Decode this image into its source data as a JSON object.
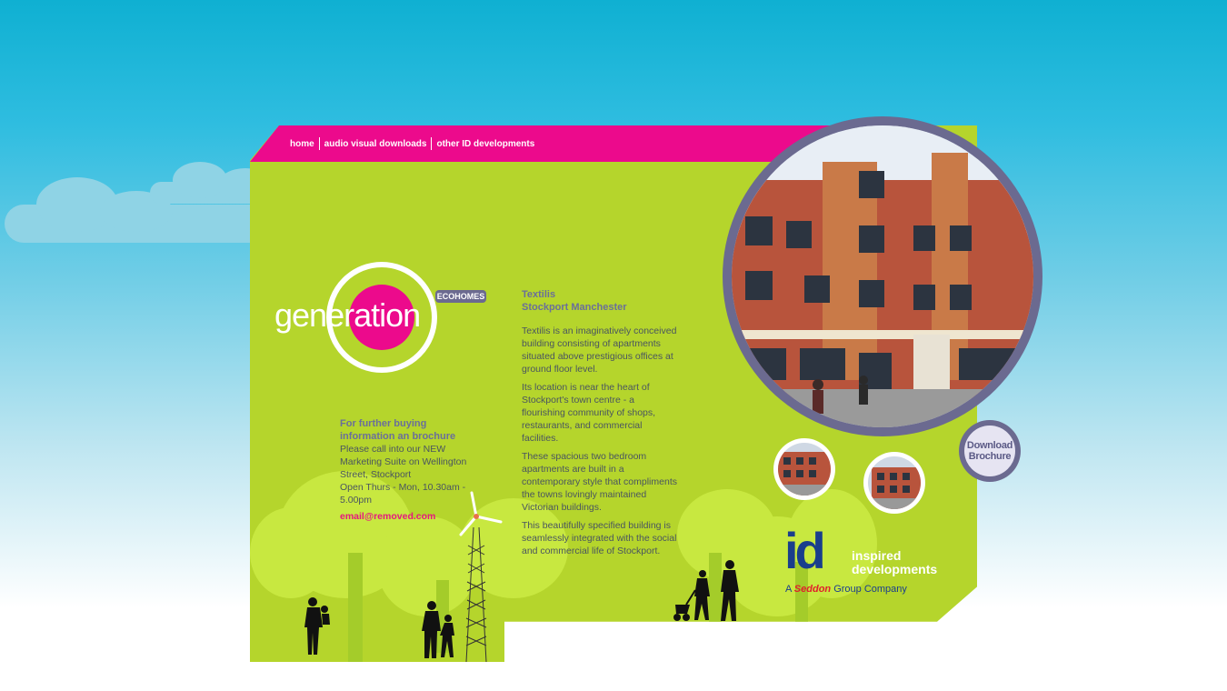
{
  "nav": {
    "items": [
      "home",
      "audio visual downloads",
      "other ID developments"
    ]
  },
  "logo": {
    "badge": "ECOHOMES",
    "word_part1": "gen",
    "word_part2": "era",
    "word_part3": "tion"
  },
  "contact": {
    "heading": "For further buying information an brochure",
    "body": "Please call into our NEW Marketing Suite on Wellington Street, Stockport",
    "hours": "Open Thurs - Mon, 10.30am - 5.00pm",
    "email": "email@removed.com"
  },
  "development": {
    "title": "Textilis",
    "location": "Stockport Manchester",
    "paragraphs": [
      "Textilis is an imaginatively conceived building consisting of apartments situated above prestigious offices at ground floor level.",
      "Its location is near the heart of Stockport's town centre - a flourishing community of shops, restaurants, and commercial facilities.",
      "These spacious two bedroom apartments are built in a contemporary style that compliments the towns lovingly maintained Victorian buildings.",
      "This beautifully specified building is seamlessly integrated with the social and commercial life of Stockport."
    ]
  },
  "download": {
    "line1": "Download",
    "line2": "Brochure"
  },
  "brand": {
    "mark": "id",
    "line1": "inspired",
    "line2": "developments",
    "tag_prefix": "A",
    "tag_brand": "Seddon",
    "tag_suffix": "Group Company"
  },
  "colors": {
    "pink": "#ec0a8c",
    "lime": "#b5d52c",
    "navy": "#1a3e8c",
    "ring": "#6b6a90"
  }
}
